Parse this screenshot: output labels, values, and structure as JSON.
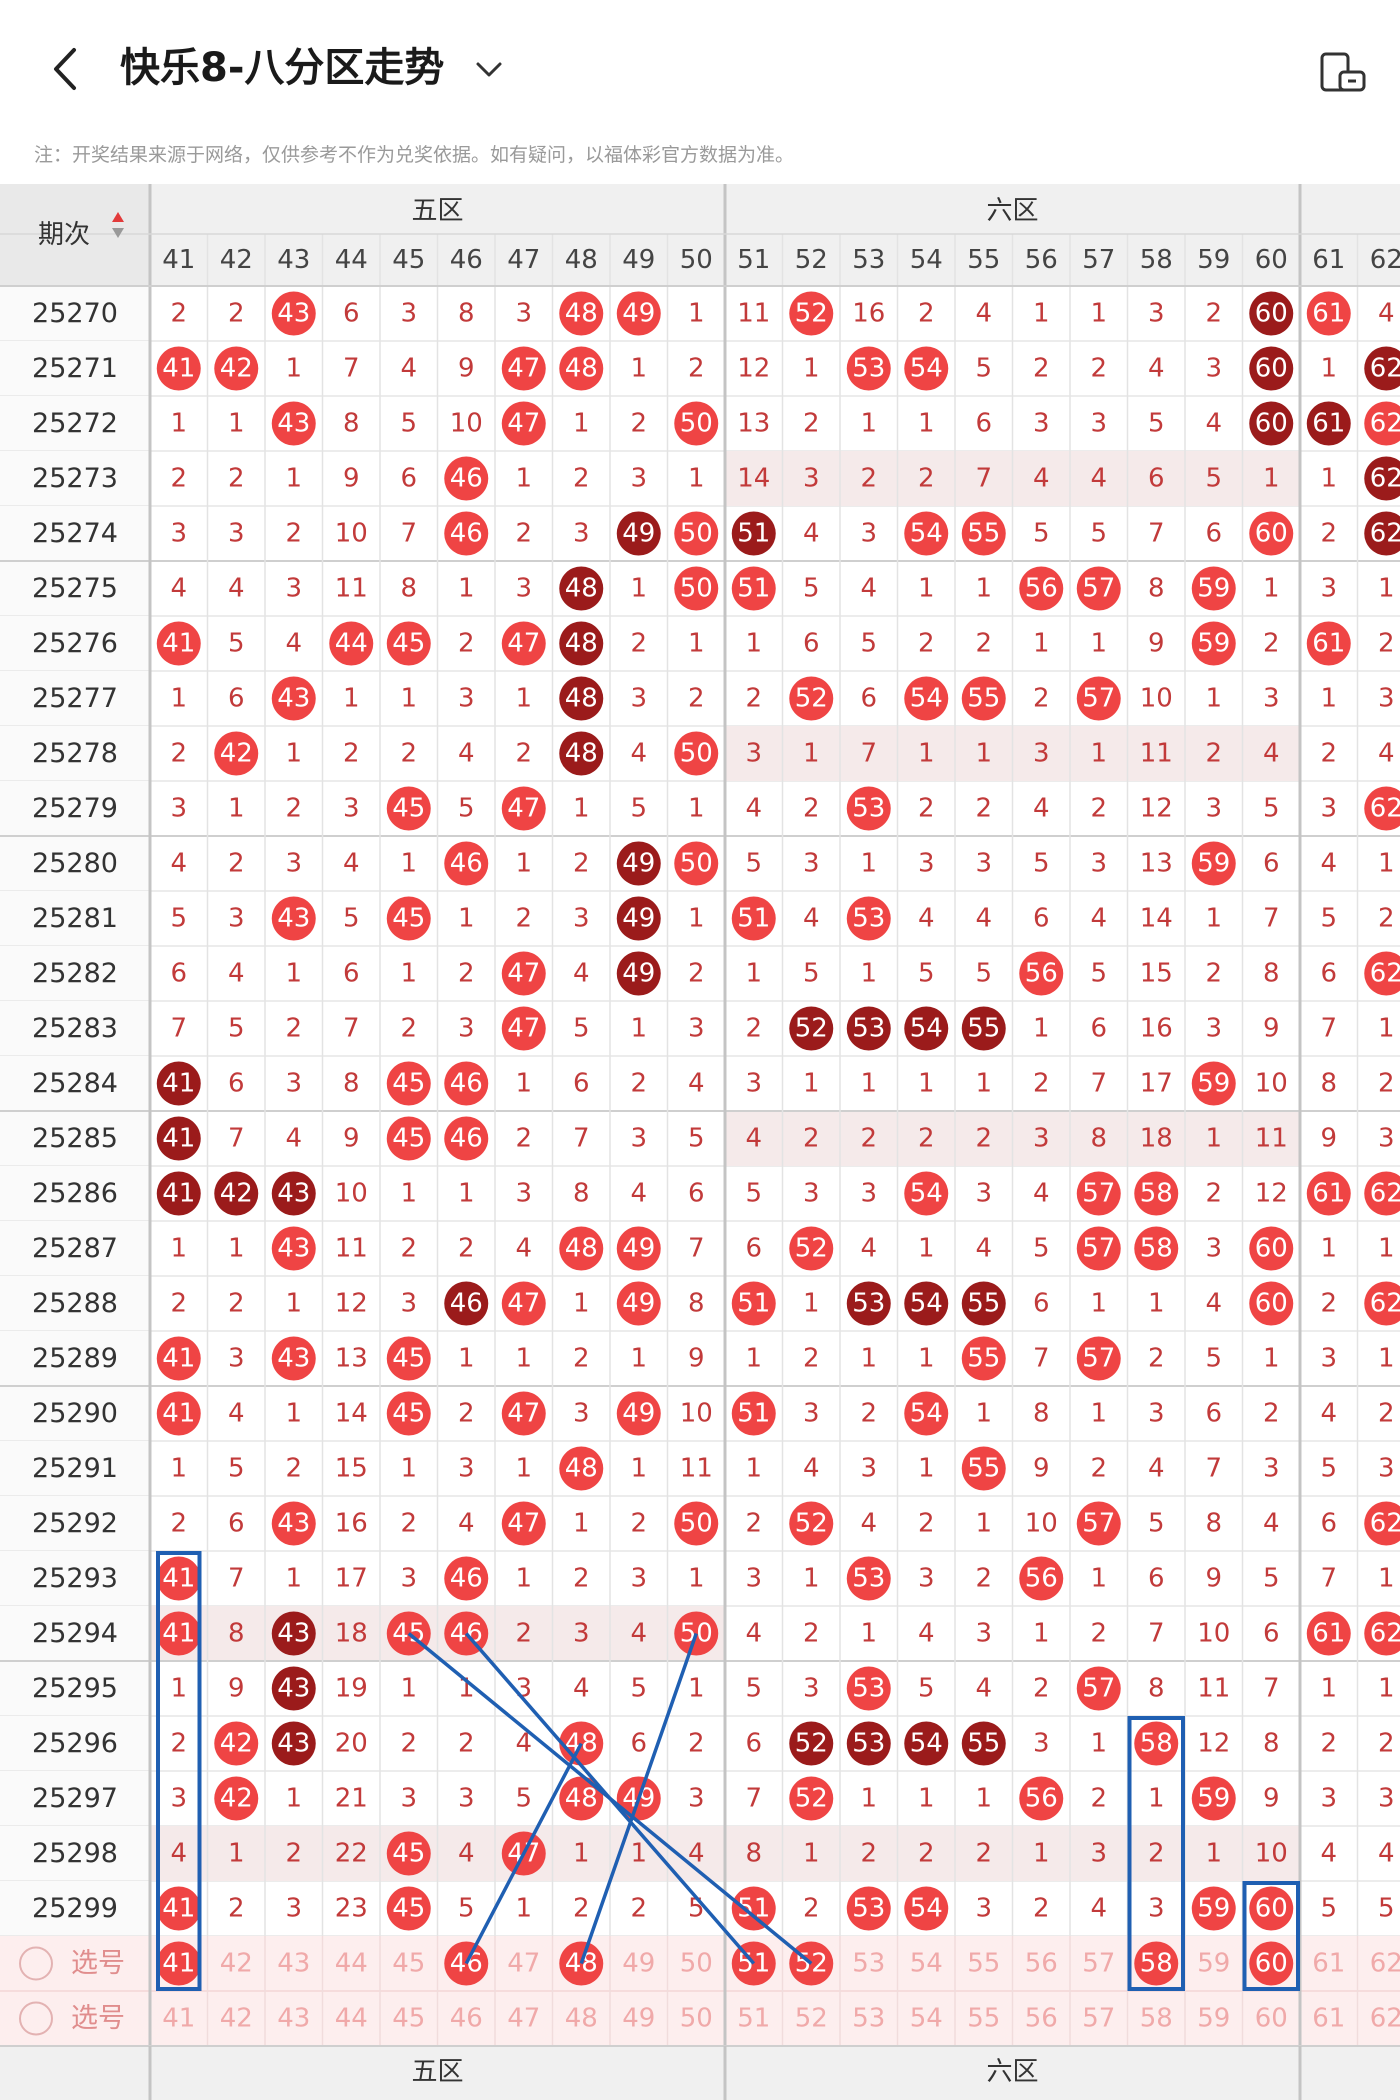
{
  "header": {
    "title": "快乐8-八分区走势",
    "note": "注：开奖结果来源于网络，仅供参考不作为兑奖依据。如有疑问，以福体彩官方数据为准。"
  },
  "table": {
    "issue_header": "期次",
    "zones": [
      {
        "name": "五区",
        "start": 41,
        "end": 50
      },
      {
        "name": "六区",
        "start": 51,
        "end": 60
      }
    ],
    "columns": [
      41,
      42,
      43,
      44,
      45,
      46,
      47,
      48,
      49,
      50,
      51,
      52,
      53,
      54,
      55,
      56,
      57,
      58,
      59,
      60,
      61,
      62
    ],
    "rows": [
      {
        "issue": "25270",
        "v": [
          2,
          2,
          43,
          6,
          3,
          8,
          3,
          48,
          49,
          1,
          11,
          52,
          16,
          2,
          4,
          1,
          1,
          3,
          2,
          60,
          61,
          4
        ]
      },
      {
        "issue": "25271",
        "v": [
          41,
          42,
          1,
          7,
          4,
          9,
          47,
          48,
          1,
          2,
          12,
          1,
          53,
          54,
          5,
          2,
          2,
          4,
          3,
          60,
          1,
          62
        ]
      },
      {
        "issue": "25272",
        "v": [
          1,
          1,
          43,
          8,
          5,
          10,
          47,
          1,
          2,
          50,
          13,
          2,
          1,
          1,
          6,
          3,
          3,
          5,
          4,
          60,
          61,
          62
        ]
      },
      {
        "issue": "25273",
        "v": [
          2,
          2,
          1,
          9,
          6,
          46,
          1,
          2,
          3,
          1,
          14,
          3,
          2,
          2,
          7,
          4,
          4,
          6,
          5,
          1,
          1,
          62
        ]
      },
      {
        "issue": "25274",
        "v": [
          3,
          3,
          2,
          10,
          7,
          46,
          2,
          3,
          49,
          50,
          51,
          4,
          3,
          54,
          55,
          5,
          5,
          7,
          6,
          60,
          2,
          62
        ]
      },
      {
        "issue": "25275",
        "v": [
          4,
          4,
          3,
          11,
          8,
          1,
          3,
          48,
          1,
          50,
          51,
          5,
          4,
          1,
          1,
          56,
          57,
          8,
          59,
          1,
          3,
          1
        ]
      },
      {
        "issue": "25276",
        "v": [
          41,
          5,
          4,
          44,
          45,
          2,
          47,
          48,
          2,
          1,
          1,
          6,
          5,
          2,
          2,
          1,
          1,
          9,
          59,
          2,
          61,
          2
        ]
      },
      {
        "issue": "25277",
        "v": [
          1,
          6,
          43,
          1,
          1,
          3,
          1,
          48,
          3,
          2,
          2,
          52,
          6,
          54,
          55,
          2,
          57,
          10,
          1,
          3,
          1,
          3
        ]
      },
      {
        "issue": "25278",
        "v": [
          2,
          42,
          1,
          2,
          2,
          4,
          2,
          48,
          4,
          50,
          3,
          1,
          7,
          1,
          1,
          3,
          1,
          11,
          2,
          4,
          2,
          4
        ]
      },
      {
        "issue": "25279",
        "v": [
          3,
          1,
          2,
          3,
          45,
          5,
          47,
          1,
          5,
          1,
          4,
          2,
          53,
          2,
          2,
          4,
          2,
          12,
          3,
          5,
          3,
          62
        ]
      },
      {
        "issue": "25280",
        "v": [
          4,
          2,
          3,
          4,
          1,
          46,
          1,
          2,
          49,
          50,
          5,
          3,
          1,
          3,
          3,
          5,
          3,
          13,
          59,
          6,
          4,
          1
        ]
      },
      {
        "issue": "25281",
        "v": [
          5,
          3,
          43,
          5,
          45,
          1,
          2,
          3,
          49,
          1,
          51,
          4,
          53,
          4,
          4,
          6,
          4,
          14,
          1,
          7,
          5,
          2
        ]
      },
      {
        "issue": "25282",
        "v": [
          6,
          4,
          1,
          6,
          1,
          2,
          47,
          4,
          49,
          2,
          1,
          5,
          1,
          5,
          5,
          56,
          5,
          15,
          2,
          8,
          6,
          62
        ]
      },
      {
        "issue": "25283",
        "v": [
          7,
          5,
          2,
          7,
          2,
          3,
          47,
          5,
          1,
          3,
          2,
          52,
          53,
          54,
          55,
          1,
          6,
          16,
          3,
          9,
          7,
          1
        ]
      },
      {
        "issue": "25284",
        "v": [
          41,
          6,
          3,
          8,
          45,
          46,
          1,
          6,
          2,
          4,
          3,
          1,
          1,
          1,
          1,
          2,
          7,
          17,
          59,
          10,
          8,
          2
        ]
      },
      {
        "issue": "25285",
        "v": [
          41,
          7,
          4,
          9,
          45,
          46,
          2,
          7,
          3,
          5,
          4,
          2,
          2,
          2,
          2,
          3,
          8,
          18,
          1,
          11,
          9,
          3
        ]
      },
      {
        "issue": "25286",
        "v": [
          41,
          42,
          43,
          10,
          1,
          1,
          3,
          8,
          4,
          6,
          5,
          3,
          3,
          54,
          3,
          4,
          57,
          58,
          2,
          12,
          61,
          62
        ]
      },
      {
        "issue": "25287",
        "v": [
          1,
          1,
          43,
          11,
          2,
          2,
          4,
          48,
          49,
          7,
          6,
          52,
          4,
          1,
          4,
          5,
          57,
          58,
          3,
          60,
          1,
          1
        ]
      },
      {
        "issue": "25288",
        "v": [
          2,
          2,
          1,
          12,
          3,
          46,
          47,
          1,
          49,
          8,
          51,
          1,
          53,
          54,
          55,
          6,
          1,
          1,
          4,
          60,
          2,
          62
        ]
      },
      {
        "issue": "25289",
        "v": [
          41,
          3,
          43,
          13,
          45,
          1,
          1,
          2,
          1,
          9,
          1,
          2,
          1,
          1,
          55,
          7,
          57,
          2,
          5,
          1,
          3,
          1
        ]
      },
      {
        "issue": "25290",
        "v": [
          41,
          4,
          1,
          14,
          45,
          2,
          47,
          3,
          49,
          10,
          51,
          3,
          2,
          54,
          1,
          8,
          1,
          3,
          6,
          2,
          4,
          2
        ]
      },
      {
        "issue": "25291",
        "v": [
          1,
          5,
          2,
          15,
          1,
          3,
          1,
          48,
          1,
          11,
          1,
          4,
          3,
          1,
          55,
          9,
          2,
          4,
          7,
          3,
          5,
          3
        ]
      },
      {
        "issue": "25292",
        "v": [
          2,
          6,
          43,
          16,
          2,
          4,
          47,
          1,
          2,
          50,
          2,
          52,
          4,
          2,
          1,
          10,
          57,
          5,
          8,
          4,
          6,
          62
        ]
      },
      {
        "issue": "25293",
        "v": [
          41,
          7,
          1,
          17,
          3,
          46,
          1,
          2,
          3,
          1,
          3,
          1,
          53,
          3,
          2,
          56,
          1,
          6,
          9,
          5,
          7,
          1
        ]
      },
      {
        "issue": "25294",
        "v": [
          41,
          8,
          43,
          18,
          45,
          46,
          2,
          3,
          4,
          50,
          4,
          2,
          1,
          4,
          3,
          1,
          2,
          7,
          10,
          6,
          61,
          62
        ]
      },
      {
        "issue": "25295",
        "v": [
          1,
          9,
          43,
          19,
          1,
          1,
          3,
          4,
          5,
          1,
          5,
          3,
          53,
          5,
          4,
          2,
          57,
          8,
          11,
          7,
          1,
          1
        ]
      },
      {
        "issue": "25296",
        "v": [
          2,
          42,
          43,
          20,
          2,
          2,
          4,
          48,
          6,
          2,
          6,
          52,
          53,
          54,
          55,
          3,
          1,
          58,
          12,
          8,
          2,
          2
        ]
      },
      {
        "issue": "25297",
        "v": [
          3,
          42,
          1,
          21,
          3,
          3,
          5,
          48,
          49,
          3,
          7,
          52,
          1,
          1,
          1,
          56,
          2,
          1,
          59,
          9,
          3,
          3
        ]
      },
      {
        "issue": "25298",
        "v": [
          4,
          1,
          2,
          22,
          45,
          4,
          47,
          1,
          1,
          4,
          8,
          1,
          2,
          2,
          2,
          1,
          3,
          2,
          1,
          10,
          4,
          4
        ]
      },
      {
        "issue": "25299",
        "v": [
          41,
          2,
          3,
          23,
          45,
          5,
          1,
          2,
          2,
          5,
          51,
          2,
          53,
          54,
          3,
          2,
          4,
          3,
          59,
          60,
          5,
          5
        ]
      }
    ],
    "dark_balls": [
      "25270-60",
      "25271-60",
      "25272-60",
      "25272-61",
      "25274-49",
      "25274-51",
      "25275-48",
      "25276-48",
      "25277-48",
      "25278-48",
      "25280-49",
      "25281-49",
      "25282-49",
      "25283-52",
      "25283-53",
      "25283-54",
      "25283-55",
      "25284-41",
      "25285-41",
      "25286-41",
      "25286-42",
      "25286-43",
      "25288-46",
      "25288-53",
      "25288-54",
      "25288-55",
      "25294-43",
      "25295-43",
      "25296-43",
      "25296-52",
      "25296-53",
      "25296-54",
      "25296-55",
      "25271-62",
      "25273-62",
      "25274-62"
    ],
    "select_label": "选号",
    "selected": [
      41,
      46,
      48,
      51,
      52,
      58,
      60
    ]
  },
  "colors": {
    "ball_red": "#ef4444",
    "ball_dark": "#9b1b1b",
    "miss_text": "#c23a3a",
    "annot_blue": "#1f5fb2"
  },
  "icons": [
    "back-icon",
    "chevron-down-icon",
    "rotate-screen-icon",
    "sort-icon",
    "radio-icon"
  ]
}
